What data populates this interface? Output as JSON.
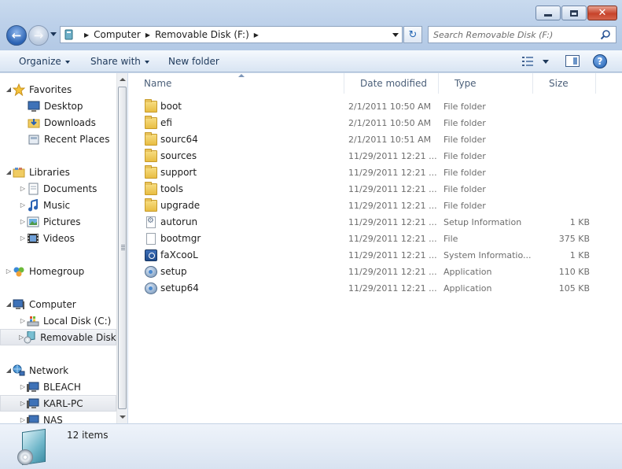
{
  "window": {
    "minimize_glyph": "minimize-icon",
    "maximize_glyph": "maximize-icon",
    "close_glyph": "✕"
  },
  "address": {
    "crumbs": [
      "Computer",
      "Removable Disk (F:)"
    ],
    "search_placeholder": "Search Removable Disk (F:)"
  },
  "toolbar": {
    "organize": "Organize",
    "share_with": "Share with",
    "new_folder": "New folder",
    "help": "?"
  },
  "nav": {
    "favorites": "Favorites",
    "desktop": "Desktop",
    "downloads": "Downloads",
    "recent_places": "Recent Places",
    "libraries": "Libraries",
    "documents": "Documents",
    "music": "Music",
    "pictures": "Pictures",
    "videos": "Videos",
    "homegroup": "Homegroup",
    "computer": "Computer",
    "local_disk": "Local Disk (C:)",
    "removable_disk": "Removable Disk (",
    "network": "Network",
    "bleach": "BLEACH",
    "karl_pc": "KARL-PC",
    "nas": "NAS"
  },
  "columns": {
    "name": "Name",
    "date_modified": "Date modified",
    "type": "Type",
    "size": "Size"
  },
  "files": [
    {
      "name": "boot",
      "date": "2/1/2011 10:50 AM",
      "type": "File folder",
      "size": "",
      "icon": "folder-icon"
    },
    {
      "name": "efi",
      "date": "2/1/2011 10:50 AM",
      "type": "File folder",
      "size": "",
      "icon": "folder-icon"
    },
    {
      "name": "sourc64",
      "date": "2/1/2011 10:51 AM",
      "type": "File folder",
      "size": "",
      "icon": "folder-icon"
    },
    {
      "name": "sources",
      "date": "11/29/2011 12:21 ...",
      "type": "File folder",
      "size": "",
      "icon": "folder-icon"
    },
    {
      "name": "support",
      "date": "11/29/2011 12:21 ...",
      "type": "File folder",
      "size": "",
      "icon": "folder-icon"
    },
    {
      "name": "tools",
      "date": "11/29/2011 12:21 ...",
      "type": "File folder",
      "size": "",
      "icon": "folder-icon"
    },
    {
      "name": "upgrade",
      "date": "11/29/2011 12:21 ...",
      "type": "File folder",
      "size": "",
      "icon": "folder-icon"
    },
    {
      "name": "autorun",
      "date": "11/29/2011 12:21 ...",
      "type": "Setup Information",
      "size": "1 KB",
      "icon": "setup-info-icon"
    },
    {
      "name": "bootmgr",
      "date": "11/29/2011 12:21 ...",
      "type": "File",
      "size": "375 KB",
      "icon": "file-icon"
    },
    {
      "name": "faXcooL",
      "date": "11/29/2011 12:21 ...",
      "type": "System Informatio...",
      "size": "1 KB",
      "icon": "system-info-icon"
    },
    {
      "name": "setup",
      "date": "11/29/2011 12:21 ...",
      "type": "Application",
      "size": "110 KB",
      "icon": "application-icon"
    },
    {
      "name": "setup64",
      "date": "11/29/2011 12:21 ...",
      "type": "Application",
      "size": "105 KB",
      "icon": "application-icon"
    }
  ],
  "details": {
    "items_count": "12 items"
  }
}
